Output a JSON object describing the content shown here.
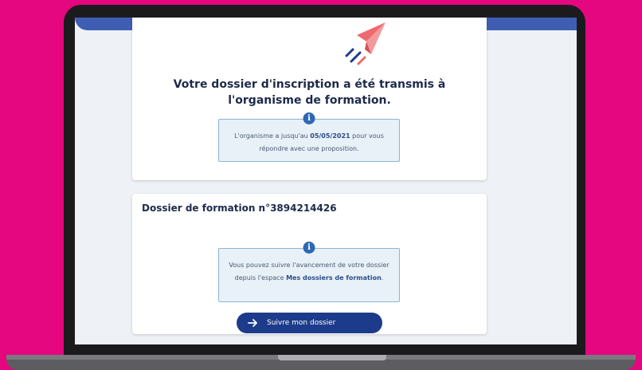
{
  "confirmation": {
    "headline": "Votre dossier d'inscription a été transmis à l'organisme de formation.",
    "notice_prefix": "L'organisme a jusqu'au ",
    "deadline": "05/05/2021",
    "notice_suffix": " pour vous répondre avec une proposition."
  },
  "dossier": {
    "title": "Dossier de formation n°3894214426",
    "notice_prefix": "Vous pouvez suivre l'avancement de votre dossier depuis l'espace ",
    "notice_link": "Mes dossiers de formation",
    "notice_suffix": ".",
    "follow_button_label": "Suivre mon dossier"
  },
  "icons": {
    "paper_plane": "paper-plane-icon",
    "info": "info-icon",
    "arrow": "arrow-right-icon"
  },
  "colors": {
    "background": "#e5077f",
    "brand_blue": "#1d3b8b",
    "plane_red": "#ef6a6f"
  }
}
